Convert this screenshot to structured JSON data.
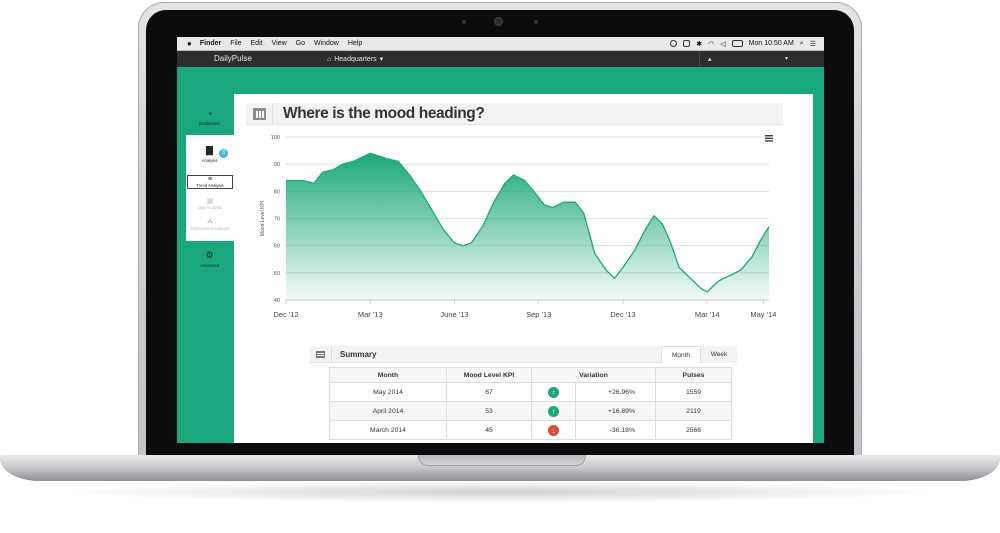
{
  "menubar": {
    "apple": "",
    "items": [
      "Finder",
      "File",
      "Edit",
      "View",
      "Go",
      "Window",
      "Help"
    ],
    "clock": "Mon 10:50 AM"
  },
  "navbar": {
    "brand": "DailyPulse",
    "location": "Headquarters",
    "location_caret": "▾",
    "user_icon": "user-icon",
    "user_caret": "▾"
  },
  "sidebar": {
    "items": [
      {
        "label": "Dashboard",
        "icon": "gauge-icon"
      },
      {
        "label": "Analysis",
        "icon": "bar-chart-icon",
        "badge": "3"
      },
      {
        "label": "Advanced",
        "icon": "gear-icon"
      }
    ],
    "sub_items": [
      {
        "label": "Trend Analysis",
        "icon": "trend-icon",
        "active": true
      },
      {
        "label": "Day Analysis",
        "icon": "calendar-icon",
        "active": false
      },
      {
        "label": "Deployment Analysis",
        "icon": "sitemap-icon",
        "active": false
      }
    ]
  },
  "page": {
    "title": "Where is the mood heading?",
    "title_icon": "calendar-icon",
    "menu_icon": "hamburger-icon"
  },
  "chart_data": {
    "type": "area",
    "title": "",
    "xlabel": "",
    "ylabel": "Mood Level KPI",
    "ylim": [
      40,
      100
    ],
    "yticks": [
      40,
      50,
      60,
      70,
      80,
      90,
      100
    ],
    "xtick_labels": [
      "Dec '12",
      "Mar '13",
      "June '13",
      "Sep '13",
      "Dec '13",
      "Mar '14",
      "May '14"
    ],
    "xtick_positions": [
      0,
      3,
      6,
      9,
      12,
      15,
      17
    ],
    "x_range": [
      0,
      17.2
    ],
    "grid": true,
    "legend": "none",
    "color": "#1aa879",
    "points": [
      [
        0.0,
        84
      ],
      [
        0.6,
        84
      ],
      [
        1.0,
        83
      ],
      [
        1.3,
        87
      ],
      [
        1.7,
        88
      ],
      [
        2.0,
        90
      ],
      [
        2.4,
        91
      ],
      [
        2.8,
        93
      ],
      [
        3.0,
        94
      ],
      [
        3.3,
        93
      ],
      [
        3.6,
        92
      ],
      [
        4.0,
        91
      ],
      [
        4.4,
        86
      ],
      [
        4.8,
        80
      ],
      [
        5.2,
        73
      ],
      [
        5.6,
        66
      ],
      [
        6.0,
        61
      ],
      [
        6.3,
        60
      ],
      [
        6.6,
        61
      ],
      [
        7.0,
        67
      ],
      [
        7.4,
        76
      ],
      [
        7.8,
        83
      ],
      [
        8.1,
        86
      ],
      [
        8.5,
        84
      ],
      [
        8.9,
        79
      ],
      [
        9.2,
        75
      ],
      [
        9.5,
        74
      ],
      [
        9.9,
        76
      ],
      [
        10.3,
        76
      ],
      [
        10.6,
        72
      ],
      [
        11.0,
        57
      ],
      [
        11.4,
        51
      ],
      [
        11.7,
        48
      ],
      [
        12.0,
        52
      ],
      [
        12.4,
        58
      ],
      [
        12.8,
        66
      ],
      [
        13.1,
        71
      ],
      [
        13.4,
        68
      ],
      [
        13.7,
        61
      ],
      [
        14.0,
        52
      ],
      [
        14.4,
        48
      ],
      [
        14.8,
        44
      ],
      [
        15.0,
        43
      ],
      [
        15.4,
        47
      ],
      [
        15.8,
        49
      ],
      [
        16.2,
        51
      ],
      [
        16.6,
        56
      ],
      [
        16.9,
        62
      ],
      [
        17.2,
        67
      ]
    ]
  },
  "summary": {
    "title": "Summary",
    "tabs": [
      "Month",
      "Week"
    ],
    "columns": [
      "Month",
      "Mood Level KPI",
      "Variation",
      "Pulses"
    ],
    "rows": [
      {
        "month": "May 2014",
        "kpi": "67",
        "trend": "up",
        "variation": "+26.96%",
        "pulses": "1559"
      },
      {
        "month": "April 2014",
        "kpi": "53",
        "trend": "up",
        "variation": "+16.89%",
        "pulses": "2119"
      },
      {
        "month": "March 2014",
        "kpi": "45",
        "trend": "down",
        "variation": "-36.18%",
        "pulses": "2566"
      }
    ],
    "colors": {
      "up": "#1aa877",
      "down": "#e04a33"
    }
  },
  "theme": {
    "accent": "#19a77e",
    "navbar": "#2d2d2d"
  }
}
